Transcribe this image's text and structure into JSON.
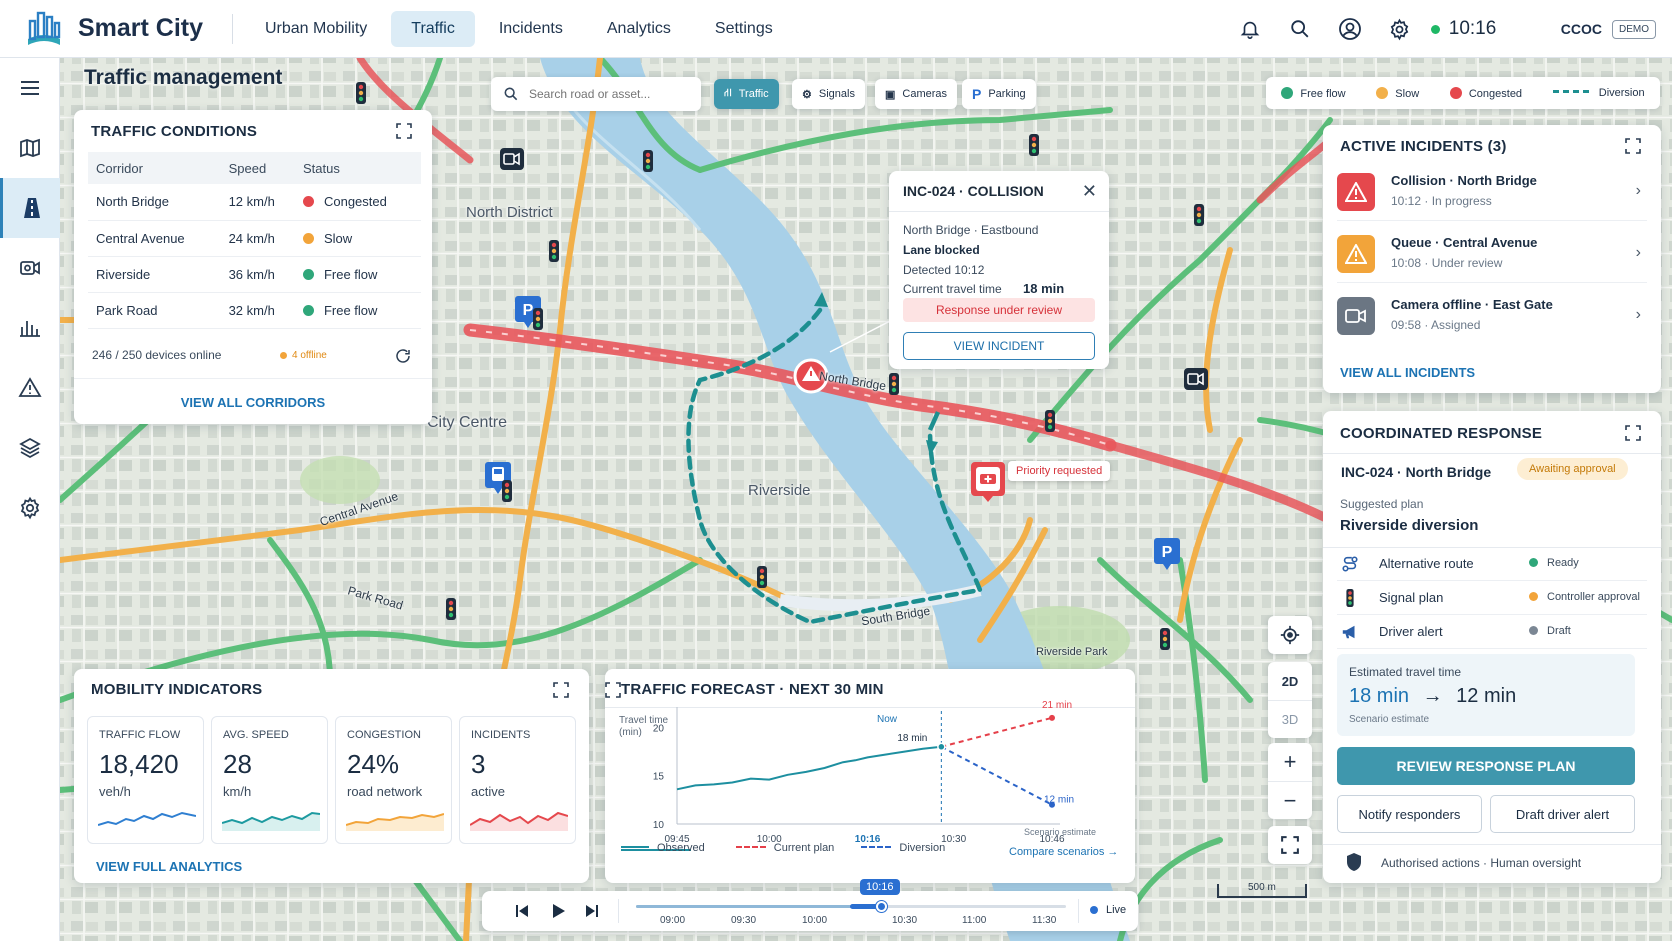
{
  "app": {
    "name": "Smart City",
    "nav": [
      "Urban Mobility",
      "Traffic",
      "Incidents",
      "Analytics",
      "Settings"
    ],
    "active_nav": "Traffic",
    "time": "10:16",
    "org": "CCOC",
    "mode_badge": "DEMO"
  },
  "rail": [
    "menu-icon",
    "map-icon",
    "road-icon",
    "camera-icon",
    "analytics-icon",
    "warning-icon",
    "layers-icon",
    "settings-icon"
  ],
  "page_title": "Traffic management",
  "search": {
    "placeholder": "Search road or asset..."
  },
  "layers": [
    {
      "label": "Traffic",
      "icon": "road-icon",
      "active": true
    },
    {
      "label": "Signals",
      "icon": "signal-icon",
      "active": false
    },
    {
      "label": "Cameras",
      "icon": "camera-icon",
      "active": false
    },
    {
      "label": "Parking",
      "icon": "parking-icon",
      "active": false
    }
  ],
  "legend": [
    {
      "label": "Free flow",
      "color": "#2fa77a"
    },
    {
      "label": "Slow",
      "color": "#f2a43a"
    },
    {
      "label": "Congested",
      "color": "#e5484d"
    },
    {
      "label": "Diversion",
      "color": "#1d8f90"
    }
  ],
  "map_labels": {
    "north_district": "North District",
    "city_centre": "City Centre",
    "riverside": "Riverside",
    "riverside_park": "Riverside Park",
    "north_bridge": "North Bridge",
    "south_bridge": "South Bridge",
    "central_avenue": "Central Avenue",
    "park_road": "Park Road",
    "priority": "Priority requested",
    "scale": "500 m"
  },
  "traffic_conditions": {
    "title": "TRAFFIC CONDITIONS",
    "headers": [
      "Corridor",
      "Speed",
      "Status"
    ],
    "rows": [
      {
        "corridor": "North Bridge",
        "speed": "12 km/h",
        "status": "Congested",
        "color": "#e5484d"
      },
      {
        "corridor": "Central Avenue",
        "speed": "24 km/h",
        "status": "Slow",
        "color": "#f2a43a"
      },
      {
        "corridor": "Riverside",
        "speed": "36 km/h",
        "status": "Free flow",
        "color": "#2fa77a"
      },
      {
        "corridor": "Park Road",
        "speed": "32 km/h",
        "status": "Free flow",
        "color": "#2fa77a"
      }
    ],
    "devices": "246 / 250 devices online",
    "offline": "4 offline",
    "link": "VIEW ALL CORRIDORS"
  },
  "incident_popup": {
    "title": "INC-024 · COLLISION",
    "location": "North Bridge · Eastbound",
    "impact": "Lane blocked",
    "detected": "Detected 10:12",
    "travel_label": "Current travel time",
    "travel_value": "18 min",
    "status": "Response under review",
    "button": "VIEW INCIDENT"
  },
  "active_incidents": {
    "title": "ACTIVE INCIDENTS (3)",
    "items": [
      {
        "title": "Collision · North Bridge",
        "meta": "10:12 · In progress",
        "color": "#e5484d",
        "icon": "warning-icon"
      },
      {
        "title": "Queue · Central Avenue",
        "meta": "10:08 · Under review",
        "color": "#f2a43a",
        "icon": "warning-icon"
      },
      {
        "title": "Camera offline · East Gate",
        "meta": "09:58 · Assigned",
        "color": "#6b7683",
        "icon": "camera-icon"
      }
    ],
    "link": "VIEW ALL INCIDENTS"
  },
  "response": {
    "title": "COORDINATED RESPONSE",
    "incident": "INC-024 · North Bridge",
    "badge": "Awaiting approval",
    "plan_label": "Suggested plan",
    "plan_name": "Riverside diversion",
    "items": [
      {
        "label": "Alternative route",
        "status": "Ready",
        "color": "#2fa77a",
        "icon": "route-icon"
      },
      {
        "label": "Signal plan",
        "status": "Controller approval",
        "color": "#f2a43a",
        "icon": "traffic-light-icon"
      },
      {
        "label": "Driver alert",
        "status": "Draft",
        "color": "#7b8794",
        "icon": "megaphone-icon"
      }
    ],
    "eta_label": "Estimated travel time",
    "eta_from": "18 min",
    "eta_to": "12 min",
    "eta_note": "Scenario estimate",
    "primary": "REVIEW RESPONSE PLAN",
    "secondary_1": "Notify responders",
    "secondary_2": "Draft driver alert",
    "footer": "Authorised actions · Human oversight"
  },
  "mobility": {
    "title": "MOBILITY INDICATORS",
    "kpis": [
      {
        "label": "TRAFFIC FLOW",
        "value": "18,420",
        "unit": "veh/h",
        "color": "#2f7fd1"
      },
      {
        "label": "AVG. SPEED",
        "value": "28",
        "unit": "km/h",
        "color": "#1d9aa0"
      },
      {
        "label": "CONGESTION",
        "value": "24%",
        "unit": "road network",
        "color": "#f2a43a"
      },
      {
        "label": "INCIDENTS",
        "value": "3",
        "unit": "active",
        "color": "#e5484d"
      }
    ],
    "link": "VIEW FULL ANALYTICS"
  },
  "forecast": {
    "title": "TRAFFIC FORECAST · NEXT 30 MIN",
    "ylabel": "Travel time (min)",
    "now_label": "Now",
    "note": "Scenario estimate",
    "link": "Compare scenarios →",
    "legend": [
      "Observed",
      "Current plan",
      "Diversion"
    ]
  },
  "chart_data": {
    "type": "line",
    "title": "TRAFFIC FORECAST · NEXT 30 MIN",
    "ylabel": "Travel time (min)",
    "x_ticks": [
      "09:45",
      "10:00",
      "10:16",
      "10:30",
      "10:46"
    ],
    "yticks": [
      10,
      15,
      20
    ],
    "ylim": [
      10,
      21.5
    ],
    "xlim": [
      0,
      61
    ],
    "series": [
      {
        "name": "Observed",
        "color": "#1d8fa0",
        "dash": false,
        "points": [
          [
            0,
            13.6
          ],
          [
            3,
            14
          ],
          [
            6,
            14.1
          ],
          [
            9,
            14.3
          ],
          [
            12,
            14.7
          ],
          [
            15,
            14.6
          ],
          [
            18,
            15.1
          ],
          [
            21,
            15.4
          ],
          [
            24,
            15.8
          ],
          [
            27,
            16.4
          ],
          [
            29,
            16.6
          ],
          [
            31,
            16.9
          ],
          [
            34,
            17.2
          ],
          [
            37,
            17.5
          ],
          [
            40,
            17.8
          ],
          [
            43,
            18
          ]
        ]
      },
      {
        "name": "Current plan",
        "color": "#e5404a",
        "dash": true,
        "points": [
          [
            43,
            18
          ],
          [
            61,
            21
          ]
        ]
      },
      {
        "name": "Diversion",
        "color": "#2a63c8",
        "dash": true,
        "points": [
          [
            43,
            18
          ],
          [
            61,
            12
          ]
        ]
      }
    ],
    "annotations": [
      {
        "x": 43,
        "y": 18,
        "text": "18 min"
      },
      {
        "x": 61,
        "y": 21,
        "text": "21 min"
      },
      {
        "x": 61,
        "y": 12,
        "text": "12 min"
      }
    ]
  },
  "controls": {
    "view_2d": "2D",
    "view_3d": "3D"
  },
  "timeline": {
    "current": "10:16",
    "ticks": [
      "09:00",
      "09:30",
      "10:00",
      "10:30",
      "11:00",
      "11:30"
    ],
    "live": "Live"
  }
}
